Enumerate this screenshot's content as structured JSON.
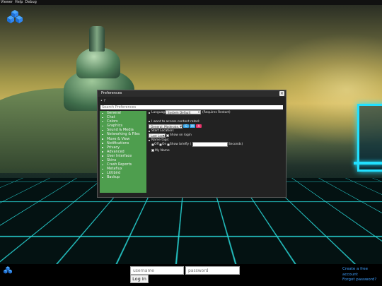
{
  "menubar": {
    "items": [
      "Viewer",
      "Help",
      "Debug"
    ]
  },
  "preferences": {
    "title": "Preferences",
    "close_glyph": "×",
    "hint": "• ?",
    "search_placeholder": "Search Preferences",
    "categories": [
      "General",
      "Chat",
      "Colors",
      "Graphics",
      "Sound & Media",
      "Networking & Files",
      "Move & View",
      "Notifications",
      "Privacy",
      "Advanced",
      "User Interface",
      "Skins",
      "Crash Reports",
      "Metaflux",
      "Littlbird",
      "Backup"
    ],
    "general": {
      "language_label": "Language:",
      "language_value": "System Default",
      "language_note": "(Requires Restart)",
      "rating_label": "I want to access content rated:",
      "rating_value": "General, Moderate, Adult",
      "rating_buttons": [
        "G",
        "M",
        "A"
      ],
      "rating_colors": [
        "#3aa6e8",
        "#3aa6e8",
        "#e8346b"
      ],
      "start_label": "Start Location:",
      "start_value": "Last Location",
      "show_on_login": "Show on login",
      "name_tags_label": "Name tags:",
      "name_tags_off": "Off",
      "name_tags_on": "On",
      "name_tags_brief": "Show briefly (",
      "name_tags_seconds": "Seconds)",
      "my_name": "My Name"
    }
  },
  "login": {
    "username_placeholder": "username",
    "password_placeholder": "password",
    "login_button": "Log In",
    "create_account": "Create a free account",
    "forgot_password": "Forgot password?"
  }
}
